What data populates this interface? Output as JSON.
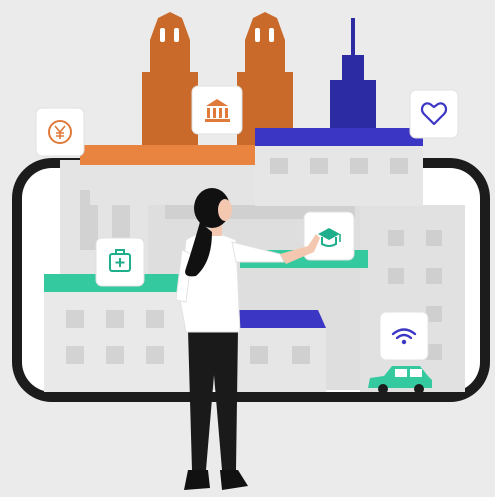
{
  "colors": {
    "background": "#ebebeb",
    "phone_frame": "#1c1c1c",
    "screen": "#ffffff",
    "building_light": "#e4e4e4",
    "building_mid": "#d6d6d6",
    "window": "#cfcfcf",
    "tower_orange": "#c96a2a",
    "roof_orange": "#e8843f",
    "tower_purple": "#2c2ba3",
    "roof_purple": "#3b36c4",
    "roof_green": "#35c9a0",
    "car_green": "#35c9a0",
    "icon_orange": "#e07a3a",
    "icon_green": "#1fae8b",
    "icon_purple": "#3b36c4",
    "hair": "#111111",
    "shirt": "#ffffff",
    "pants": "#1a1a1a",
    "skin": "#f4c8b0"
  },
  "icons": [
    "yen-coin-icon",
    "bank-icon",
    "heart-icon",
    "first-aid-kit-icon",
    "graduation-cap-icon",
    "wifi-icon"
  ],
  "illustration": {
    "subject": "person-touching-phone-screen",
    "scene": "city-buildings-on-phone"
  }
}
